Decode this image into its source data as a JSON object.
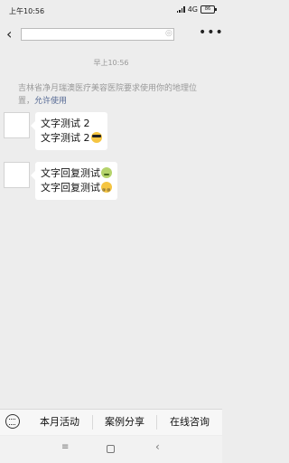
{
  "status_bar": {
    "time": "上午10:56",
    "network": "4G",
    "battery": "86"
  },
  "title_bar": {
    "back_icon": "chevron-left-icon",
    "address_value": "",
    "more_icon": "more-dots-icon"
  },
  "chat": {
    "timestamp": "早上10:56",
    "notice_text": "吉林省净月瑞澳医疗美容医院要求使用你的地理位置，",
    "notice_link": "允许使用",
    "messages": [
      {
        "line1": "文字测试 2",
        "line2": "文字测试 2",
        "emoji2": "sunglasses-emoji"
      },
      {
        "line1": "文字回复测试",
        "emoji1": "sick-face-emoji",
        "line2": "文字回复测试",
        "emoji2": "dizzy-face-emoji"
      }
    ]
  },
  "bottom_menu": {
    "keyboard_icon": "keyboard-icon",
    "items": [
      "本月活动",
      "案例分享",
      "在线咨询"
    ]
  },
  "android_nav": {
    "menu": "≡",
    "home": "home-icon",
    "back": "‹"
  }
}
